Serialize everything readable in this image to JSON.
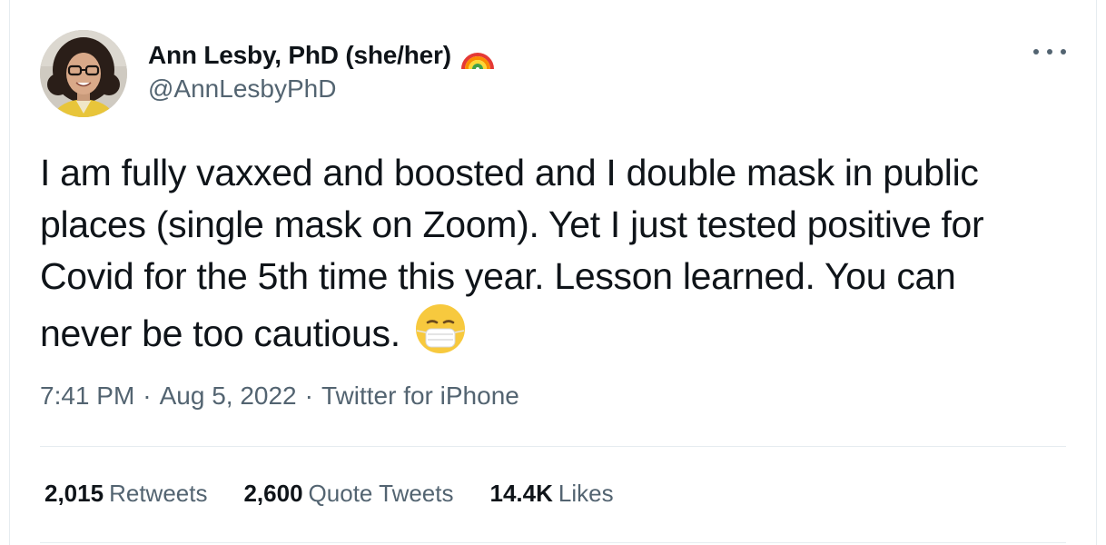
{
  "author": {
    "display_name": "Ann Lesby, PhD (she/her)",
    "handle": "@AnnLesbyPhD",
    "name_emoji_icon": "rainbow-icon",
    "avatar_icon": "profile-photo"
  },
  "tweet": {
    "text": "I am fully vaxxed and boosted and I double mask in public places (single mask on Zoom). Yet I just tested positive for Covid for the 5th time this year. Lesson learned. You can never be too cautious.",
    "trailing_emoji_icon": "face-with-medical-mask-icon"
  },
  "meta": {
    "time": "7:41 PM",
    "date": "Aug 5, 2022",
    "source": "Twitter for iPhone",
    "separator": "·"
  },
  "stats": {
    "retweets_count": "2,015",
    "retweets_label": "Retweets",
    "quotes_count": "2,600",
    "quotes_label": "Quote Tweets",
    "likes_count": "14.4K",
    "likes_label": "Likes"
  },
  "colors": {
    "text_primary": "#0f1419",
    "text_secondary": "#536471",
    "border": "#e6ecf0"
  }
}
